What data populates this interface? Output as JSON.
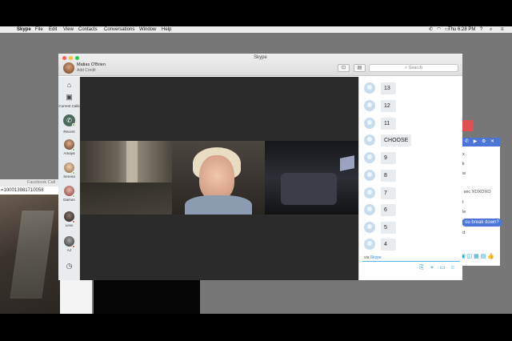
{
  "menubar": {
    "app_name": "Skype",
    "menus": [
      "File",
      "Edit",
      "View",
      "Contacts",
      "Conversations",
      "Window",
      "Help"
    ],
    "clock": "Thu 6:28 PM"
  },
  "facebook_call": {
    "title": "Facebook Call",
    "url": "=100013981710058"
  },
  "messenger": {
    "rows": [
      "ex",
      "ck",
      "ow",
      "a sec XOXOXO",
      "ut",
      "ole",
      "ou break down?",
      "od"
    ]
  },
  "skype": {
    "window_title": "Skype",
    "profile_name": "Matias O'Brien",
    "profile_sub": "Add Credit",
    "search_placeholder": "Search",
    "sidebar": {
      "current_calls": "Current Calls",
      "recent": "Recent",
      "contacts": [
        "Amaya",
        "Serena",
        "Damon",
        "Lexx",
        "AJ"
      ]
    },
    "chat": {
      "messages": [
        "13",
        "12",
        "11",
        "CHOOSE",
        "9",
        "8",
        "7",
        "6",
        "5",
        "4"
      ],
      "via_prefix": "via",
      "via_service": "Skype"
    }
  },
  "colors": {
    "skype_blue": "#1a9be0",
    "messenger_blue": "#4a76d6",
    "status_green": "#6ec34a",
    "status_red": "#d9342b"
  }
}
